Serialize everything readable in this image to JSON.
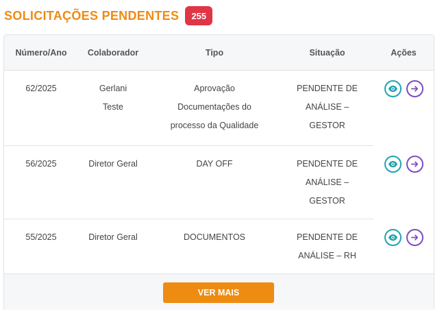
{
  "colors": {
    "title": "#ef8a12",
    "badge": "#e03545",
    "view_icon": "#1fa3b0",
    "go_icon": "#7d4bc2",
    "button": "#ee8c12"
  },
  "header": {
    "title": "SOLICITAÇÕES PENDENTES",
    "count": "255"
  },
  "table": {
    "columns": [
      "Número/Ano",
      "Colaborador",
      "Tipo",
      "Situação",
      "Ações"
    ],
    "rows": [
      {
        "numero": "62/2025",
        "colaborador": [
          "Gerlani",
          "Teste"
        ],
        "tipo": [
          "Aprovação",
          "Documentações do",
          "processo da Qualidade"
        ],
        "situacao": [
          "PENDENTE DE",
          "ANÁLISE –",
          "GESTOR"
        ],
        "icons": [
          "eye-icon",
          "arrow-right-circle-icon"
        ]
      },
      {
        "numero": "56/2025",
        "colaborador": [
          "Diretor Geral"
        ],
        "tipo": [
          "DAY OFF"
        ],
        "situacao": [
          "PENDENTE DE",
          "ANÁLISE –",
          "GESTOR"
        ],
        "icons": [
          "eye-icon",
          "arrow-right-circle-icon"
        ]
      },
      {
        "numero": "55/2025",
        "colaborador": [
          "Diretor Geral"
        ],
        "tipo": [
          "DOCUMENTOS"
        ],
        "situacao": [
          "PENDENTE DE",
          "ANÁLISE – RH"
        ],
        "icons": [
          "eye-icon",
          "arrow-right-circle-icon"
        ]
      }
    ]
  },
  "footer": {
    "more_label": "VER MAIS"
  }
}
